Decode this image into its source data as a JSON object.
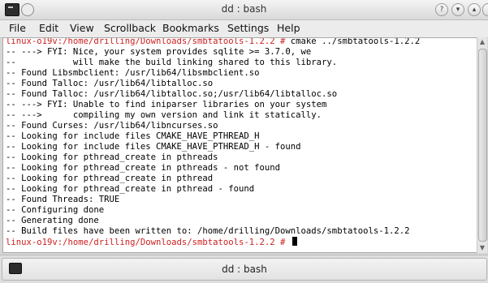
{
  "window": {
    "title": "dd : bash",
    "icons": [
      "terminal-app-icon",
      "pin-icon",
      "help-icon",
      "minimize-icon",
      "maximize-icon",
      "close-icon"
    ]
  },
  "menu": [
    "File",
    "Edit",
    "View",
    "Scrollback",
    "Bookmarks",
    "Settings",
    "Help"
  ],
  "terminal": {
    "lines": [
      {
        "prompt": "linux-o19v:/home/drilling/Downloads/smbtatools-1.2.2 # ",
        "text": "cmake ../smbtatools-1.2.2"
      },
      {
        "prompt": "",
        "text": "-- ---> FYI: Nice, your system provides sqlite >= 3.7.0, we"
      },
      {
        "prompt": "",
        "text": "--           will make the build linking shared to this library."
      },
      {
        "prompt": "",
        "text": "-- Found Libsmbclient: /usr/lib64/libsmbclient.so"
      },
      {
        "prompt": "",
        "text": "-- Found Talloc: /usr/lib64/libtalloc.so"
      },
      {
        "prompt": "",
        "text": "-- Found Talloc: /usr/lib64/libtalloc.so;/usr/lib64/libtalloc.so"
      },
      {
        "prompt": "",
        "text": "-- ---> FYI: Unable to find iniparser libraries on your system"
      },
      {
        "prompt": "",
        "text": "-- --->      compiling my own version and link it statically."
      },
      {
        "prompt": "",
        "text": "-- Found Curses: /usr/lib64/libncurses.so"
      },
      {
        "prompt": "",
        "text": "-- Looking for include files CMAKE_HAVE_PTHREAD_H"
      },
      {
        "prompt": "",
        "text": "-- Looking for include files CMAKE_HAVE_PTHREAD_H - found"
      },
      {
        "prompt": "",
        "text": "-- Looking for pthread_create in pthreads"
      },
      {
        "prompt": "",
        "text": "-- Looking for pthread_create in pthreads - not found"
      },
      {
        "prompt": "",
        "text": "-- Looking for pthread_create in pthread"
      },
      {
        "prompt": "",
        "text": "-- Looking for pthread_create in pthread - found"
      },
      {
        "prompt": "",
        "text": "-- Found Threads: TRUE"
      },
      {
        "prompt": "",
        "text": "-- Configuring done"
      },
      {
        "prompt": "",
        "text": "-- Generating done"
      },
      {
        "prompt": "",
        "text": "-- Build files have been written to: /home/drilling/Downloads/smbtatools-1.2.2"
      },
      {
        "prompt": "linux-o19v:/home/drilling/Downloads/smbtatools-1.2.2 # ",
        "text": ""
      }
    ]
  },
  "tab": {
    "label": "dd : bash"
  },
  "colors": {
    "prompt": "#cc1f1f",
    "text": "#000000",
    "background": "#ffffff"
  }
}
